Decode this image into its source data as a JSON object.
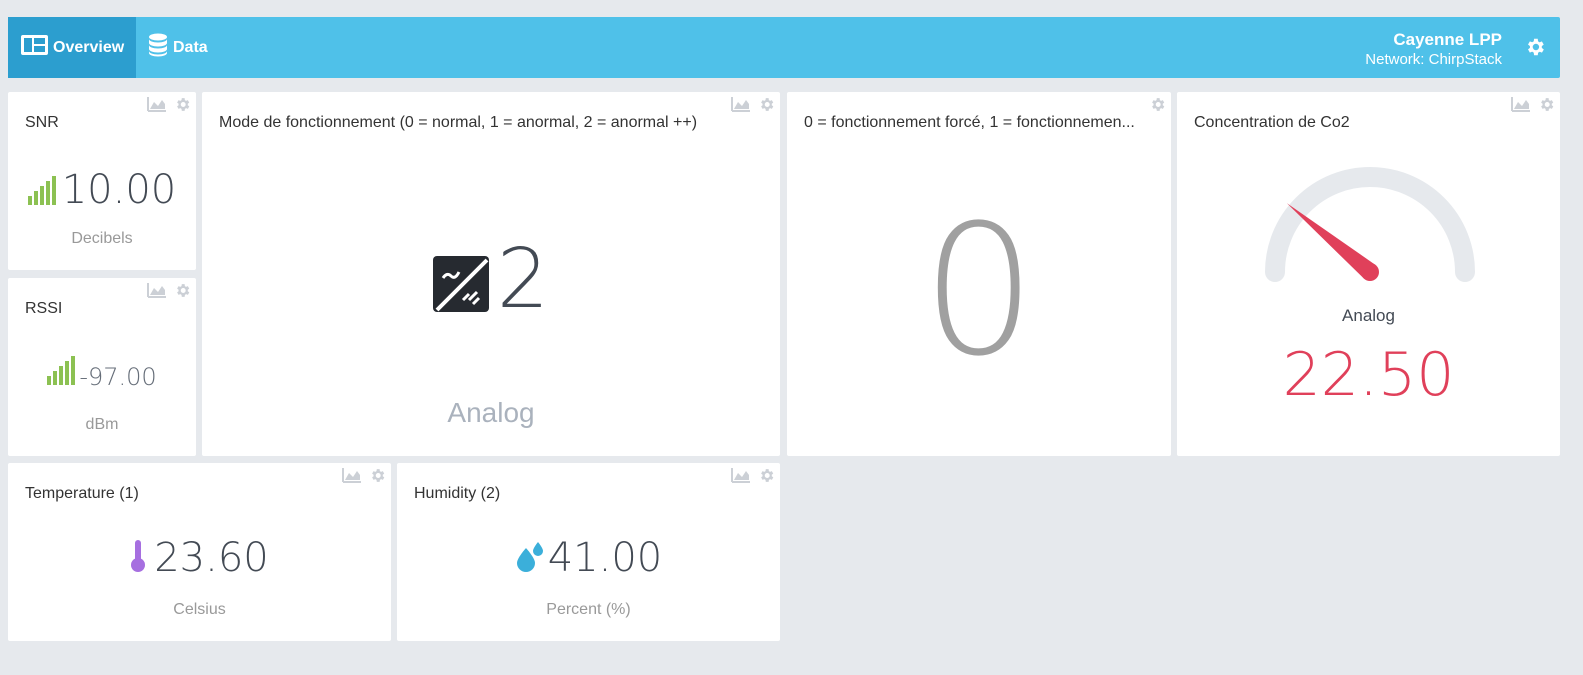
{
  "header": {
    "tabs": [
      {
        "label": "Overview",
        "icon": "dashboard-icon"
      },
      {
        "label": "Data",
        "icon": "database-icon"
      }
    ],
    "device_name": "Cayenne LPP",
    "network": "Network: ChirpStack",
    "colors": {
      "bar": "#4fc1e9",
      "active_tab": "#2c9ecf"
    }
  },
  "widgets": {
    "snr": {
      "title": "SNR",
      "value": "10.00",
      "unit": "Decibels",
      "icon": "signal-bars-icon"
    },
    "rssi": {
      "title": "RSSI",
      "value": "-97.00",
      "unit": "dBm",
      "icon": "signal-bars-icon"
    },
    "mode": {
      "title": "Mode de fonctionnement (0 = normal, 1 = anormal, 2 = anormal ++)",
      "value": "2",
      "footer": "Analog",
      "icon": "analog-sensor-icon"
    },
    "forced": {
      "title": "0 = fonctionnement forcé, 1 = fonctionnemen...",
      "value": "0"
    },
    "co2": {
      "title": "Concentration de Co2",
      "label": "Analog",
      "value": "22.50",
      "gauge_fraction": 0.22,
      "value_color": "#e0405a"
    },
    "temperature": {
      "title": "Temperature (1)",
      "value": "23.60",
      "unit": "Celsius",
      "icon": "thermometer-icon"
    },
    "humidity": {
      "title": "Humidity (2)",
      "value": "41.00",
      "unit": "Percent (%)",
      "icon": "water-drops-icon"
    }
  }
}
